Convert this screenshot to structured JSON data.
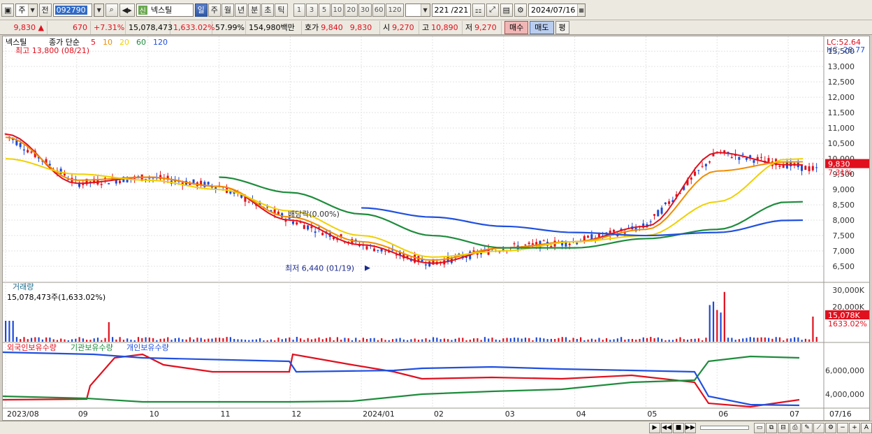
{
  "toolbar": {
    "market": "주",
    "prev_label": "전",
    "code": "092790",
    "new_badge": "신",
    "name": "넥스틸",
    "periods": [
      "일",
      "주",
      "월",
      "년",
      "분",
      "초",
      "틱"
    ],
    "active_period": "일",
    "intervals": [
      "1",
      "3",
      "5",
      "10",
      "20",
      "30",
      "60",
      "120"
    ],
    "count_current": "221",
    "count_total": "/221",
    "date": "2024/07/16"
  },
  "quote": {
    "price": "9,830",
    "arrow": "▲",
    "change": "670",
    "change_pct": "+7.31%",
    "volume": "15,078,473",
    "volume_pct": "1,633.02%",
    "ratio": "57.99%",
    "amount": "154,980백만",
    "hoga_label": "호가",
    "hoga_ask": "9,840",
    "hoga_bid": "9,830",
    "open_label": "시",
    "open": "9,270",
    "high_label": "고",
    "high": "10,890",
    "low_label": "저",
    "low": "9,270",
    "buy_label": "매수",
    "sell_label": "매도",
    "flat_label": "평"
  },
  "legend": {
    "name": "넥스틸",
    "ma_label": "종가 단순",
    "periods": [
      "5",
      "10",
      "20",
      "60",
      "120"
    ],
    "period_colors": [
      "#e0101e",
      "#f08c00",
      "#f0d000",
      "#1e8c3c",
      "#2050e0"
    ],
    "max_label": "최고 13,800 (08/21)",
    "min_label": "최저 6,440 (01/19)",
    "dividend_label": "배당락(0.00%)"
  },
  "right_labels": {
    "lc": "LC:52.64",
    "hc": "HC:-28.77",
    "price_tag": "9,830",
    "price_pct": "7.31%",
    "vol_tag": "15,078K",
    "vol_pct": "1633.02%"
  },
  "volume_panel": {
    "title": "거래량",
    "value": "15,078,473주(1,633.02%)",
    "ticks": [
      "30,000K",
      "20,000K"
    ]
  },
  "holdings_panel": {
    "labels": [
      "외국인보유수량",
      "기관보유수량",
      "개인보유수량"
    ],
    "colors": [
      "#e0101e",
      "#1e8c3c",
      "#2050e0"
    ],
    "ticks": [
      "6,000,000",
      "4,000,000"
    ]
  },
  "x_axis": {
    "labels": [
      "2023/08",
      "09",
      "10",
      "11",
      "12",
      "2024/01",
      "02",
      "03",
      "04",
      "05",
      "06",
      "07"
    ],
    "right_date": "07/16"
  },
  "chart_data": {
    "type": "line",
    "title": "넥스틸",
    "y_ticks": [
      6500,
      7000,
      7500,
      8000,
      8500,
      9000,
      9500,
      10000,
      10500,
      11000,
      11500,
      12000,
      12500,
      13000,
      13500
    ],
    "ylim": [
      6000,
      13800
    ],
    "x": [
      "2023/08",
      "09",
      "10",
      "11",
      "12",
      "2024/01",
      "02",
      "03",
      "04",
      "05",
      "06",
      "07"
    ],
    "series": [
      {
        "name": "5",
        "values": [
          10800,
          9200,
          9400,
          9100,
          8000,
          7200,
          6600,
          7100,
          7300,
          7800,
          10200,
          9800
        ]
      },
      {
        "name": "10",
        "values": [
          10700,
          9300,
          9400,
          9100,
          8100,
          7300,
          6700,
          7100,
          7300,
          7700,
          9600,
          9900
        ]
      },
      {
        "name": "20",
        "values": [
          10000,
          9500,
          9300,
          9000,
          8300,
          7500,
          6800,
          7000,
          7300,
          7500,
          8600,
          10000
        ]
      },
      {
        "name": "60",
        "values": [
          null,
          null,
          null,
          9400,
          8900,
          8200,
          7500,
          7100,
          7100,
          7400,
          7700,
          8600
        ]
      },
      {
        "name": "120",
        "values": [
          null,
          null,
          null,
          null,
          null,
          8400,
          8100,
          7800,
          7600,
          7500,
          7600,
          8000
        ]
      }
    ],
    "annotations": {
      "high": 13800,
      "low": 6440,
      "last": 9830
    }
  }
}
